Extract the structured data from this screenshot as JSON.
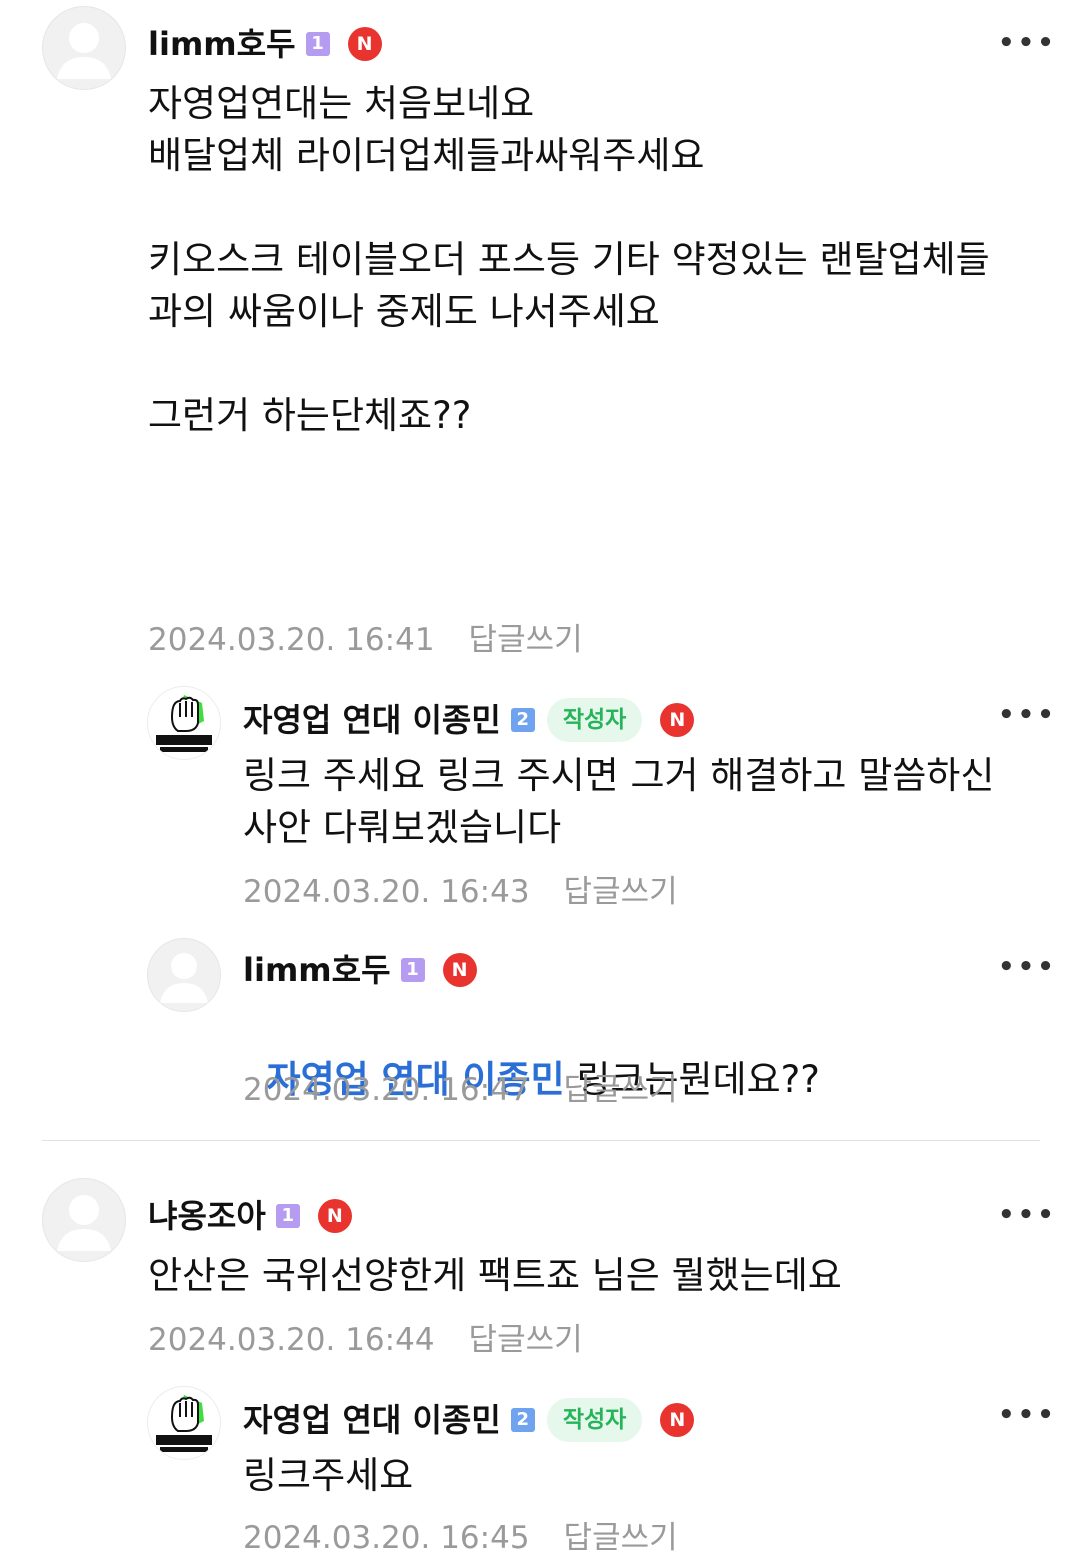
{
  "comments": [
    {
      "nickname": "limm호두",
      "level": "1",
      "new_badge": "N",
      "text": "자영업연대는 처음보네요\n배달업체 라이더업체들과싸워주세요\n\n키오스크 테이블오더 포스등 기타 약정있는 랜탈업체들\n과의 싸움이나 중제도 나서주세요\n\n그런거 하는단체죠??",
      "date": "2024.03.20. 16:41",
      "reply_label": "답글쓰기",
      "replies": [
        {
          "nickname": "자영업 연대 이종민",
          "level": "2",
          "author_tag": "작성자",
          "new_badge": "N",
          "text": "링크 주세요 링크 주시면 그거 해결하고 말씀하신\n사안 다뤄보겠습니다",
          "date": "2024.03.20. 16:43",
          "reply_label": "답글쓰기"
        },
        {
          "nickname": "limm호두",
          "level": "1",
          "new_badge": "N",
          "mention": "자영업 연대 이종민",
          "text": " 링크는뭔데요??",
          "date": "2024.03.20. 16:47",
          "reply_label": "답글쓰기"
        }
      ]
    },
    {
      "nickname": "냐옹조아",
      "level": "1",
      "new_badge": "N",
      "text": "안산은 국위선양한게 팩트죠 님은 뭘했는데요",
      "date": "2024.03.20. 16:44",
      "reply_label": "답글쓰기",
      "replies": [
        {
          "nickname": "자영업 연대 이종민",
          "level": "2",
          "author_tag": "작성자",
          "new_badge": "N",
          "text": "링크주세요",
          "date": "2024.03.20. 16:45",
          "reply_label": "답글쓰기"
        }
      ]
    }
  ],
  "icons": {
    "more": "more-dots-icon",
    "default_avatar": "user-silhouette-icon",
    "logo_avatar": "fist-logo-icon"
  },
  "colors": {
    "mention": "#2b6fd6",
    "new_badge": "#e8332e",
    "author_tag_bg": "#e6f7ec",
    "author_tag_text": "#27b35a",
    "level1": "#b59cf0",
    "level2": "#6fa3f0",
    "meta": "#9a9a9a"
  }
}
